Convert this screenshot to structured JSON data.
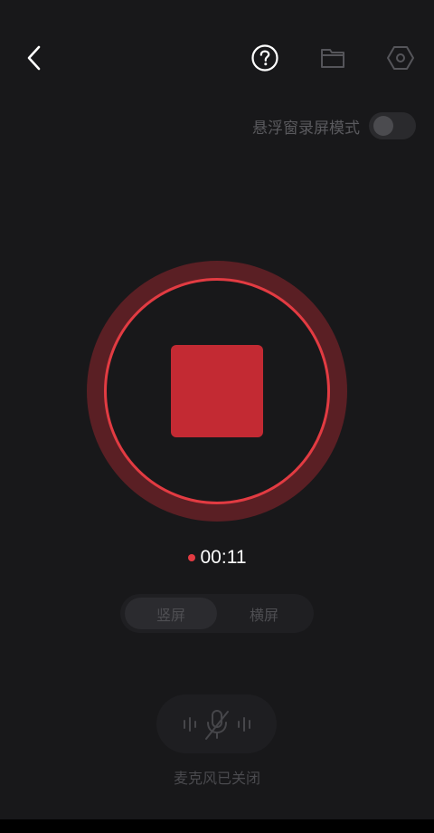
{
  "header": {
    "back_icon": "chevron-left-icon",
    "help_icon": "help-circle-icon",
    "folder_icon": "folder-icon",
    "settings_icon": "hexagon-settings-icon"
  },
  "floating_window": {
    "label": "悬浮窗录屏模式",
    "enabled": false
  },
  "recorder": {
    "state": "recording",
    "stop_icon": "stop-square-icon",
    "elapsed": "00:11"
  },
  "orientation": {
    "options": [
      "竖屏",
      "横屏"
    ],
    "selected": "竖屏"
  },
  "microphone": {
    "icon": "mic-off-icon",
    "status": "麦克风已关闭"
  },
  "colors": {
    "background": "#18181a",
    "accent": "#e23b42",
    "stop": "#c32a33",
    "outer_ring": "#5a1f24"
  }
}
